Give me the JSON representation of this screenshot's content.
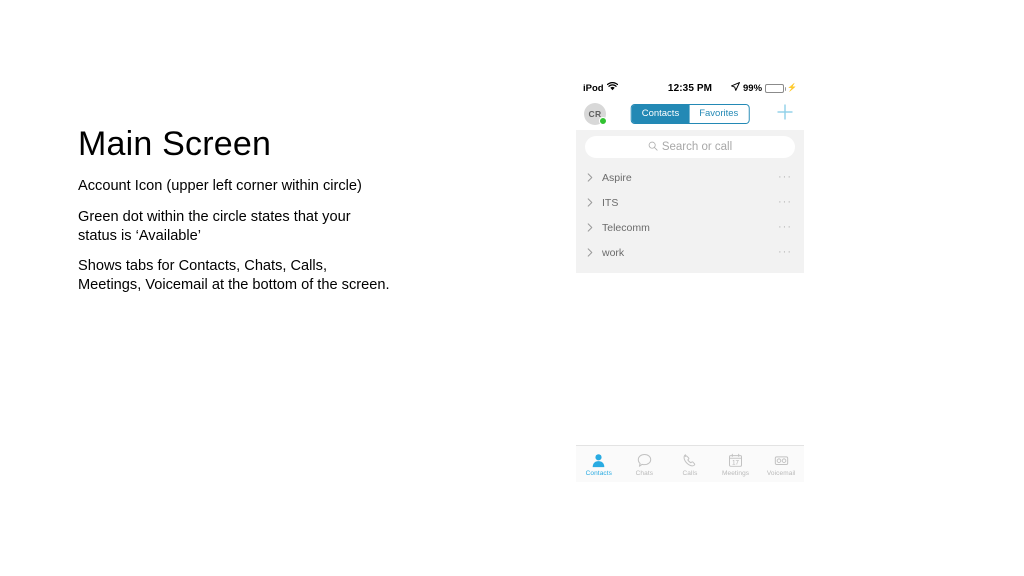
{
  "slide": {
    "title": "Main Screen",
    "paragraphs": [
      "Account Icon (upper left corner within circle)",
      "Green dot within the circle states that your status is ‘Available’",
      "Shows tabs for Contacts, Chats, Calls, Meetings, Voicemail at the bottom of the screen."
    ]
  },
  "phone": {
    "status_bar": {
      "carrier": "iPod",
      "wifi_icon": "wifi-icon",
      "time": "12:35 PM",
      "location_icon": "location-arrow-icon",
      "battery_percent": "99%",
      "battery_level": 99,
      "charging_icon": "lightning-bolt-icon"
    },
    "nav_bar": {
      "avatar": {
        "initials": "CR",
        "presence": "available",
        "presence_color": "#31c231"
      },
      "segmented_control": {
        "options": [
          {
            "label": "Contacts",
            "active": true
          },
          {
            "label": "Favorites",
            "active": false
          }
        ],
        "accent_color": "#2389b5"
      },
      "add_button": {
        "icon": "plus-icon",
        "color": "#8fd0e8"
      }
    },
    "search": {
      "icon": "search-icon",
      "placeholder": "Search or call",
      "value": ""
    },
    "contact_groups": [
      {
        "label": "Aspire",
        "expand_icon": "chevron-right-icon",
        "more_icon": "ellipsis-icon",
        "more_label": "···"
      },
      {
        "label": "ITS",
        "expand_icon": "chevron-right-icon",
        "more_icon": "ellipsis-icon",
        "more_label": "···"
      },
      {
        "label": "Telecomm",
        "expand_icon": "chevron-right-icon",
        "more_icon": "ellipsis-icon",
        "more_label": "···"
      },
      {
        "label": "work",
        "expand_icon": "chevron-right-icon",
        "more_icon": "ellipsis-icon",
        "more_label": "···"
      }
    ],
    "tab_bar": {
      "active_color": "#29abe2",
      "inactive_color": "#b9b9b9",
      "tabs": [
        {
          "label": "Contacts",
          "icon": "person-icon",
          "active": true
        },
        {
          "label": "Chats",
          "icon": "chat-bubble-icon",
          "active": false
        },
        {
          "label": "Calls",
          "icon": "phone-handset-icon",
          "active": false
        },
        {
          "label": "Meetings",
          "icon": "calendar-icon",
          "active": false,
          "calendar_day": "17"
        },
        {
          "label": "Voicemail",
          "icon": "voicemail-icon",
          "active": false
        }
      ]
    }
  }
}
